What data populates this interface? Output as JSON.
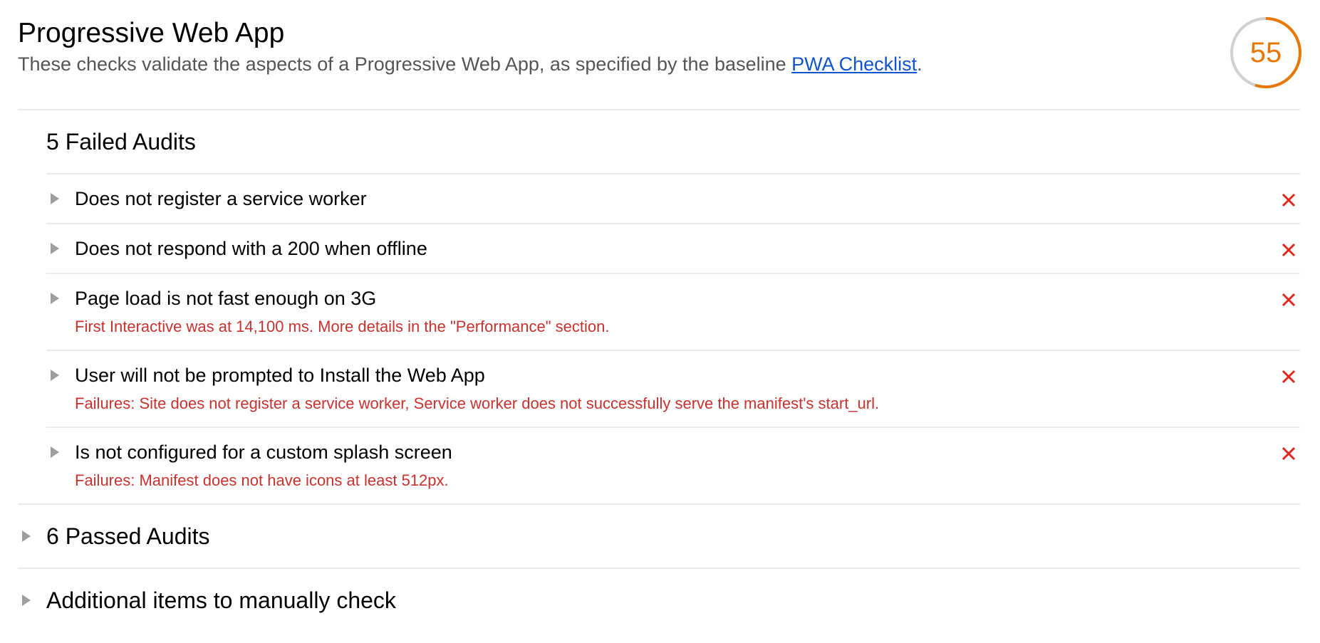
{
  "header": {
    "title": "Progressive Web App",
    "description_prefix": "These checks validate the aspects of a Progressive Web App, as specified by the baseline ",
    "link_text": "PWA Checklist",
    "description_suffix": "."
  },
  "score": {
    "value": "55",
    "fraction": 0.55,
    "color": "#e67700",
    "track_color": "#d0d0d0"
  },
  "failed_group": {
    "label": "5 Failed Audits",
    "items": [
      {
        "title": "Does not register a service worker",
        "detail": null,
        "status_icon": "cross-icon"
      },
      {
        "title": "Does not respond with a 200 when offline",
        "detail": null,
        "status_icon": "cross-icon"
      },
      {
        "title": "Page load is not fast enough on 3G",
        "detail": "First Interactive was at 14,100 ms. More details in the \"Performance\" section.",
        "status_icon": "cross-icon"
      },
      {
        "title": "User will not be prompted to Install the Web App",
        "detail": "Failures: Site does not register a service worker, Service worker does not successfully serve the manifest's start_url.",
        "status_icon": "cross-icon"
      },
      {
        "title": "Is not configured for a custom splash screen",
        "detail": "Failures: Manifest does not have icons at least 512px.",
        "status_icon": "cross-icon"
      }
    ]
  },
  "passed_group": {
    "label": "6 Passed Audits"
  },
  "manual_group": {
    "label": "Additional items to manually check"
  },
  "colors": {
    "fail": "#e0291d",
    "detail_text": "#c7322f",
    "link": "#1155cc"
  }
}
